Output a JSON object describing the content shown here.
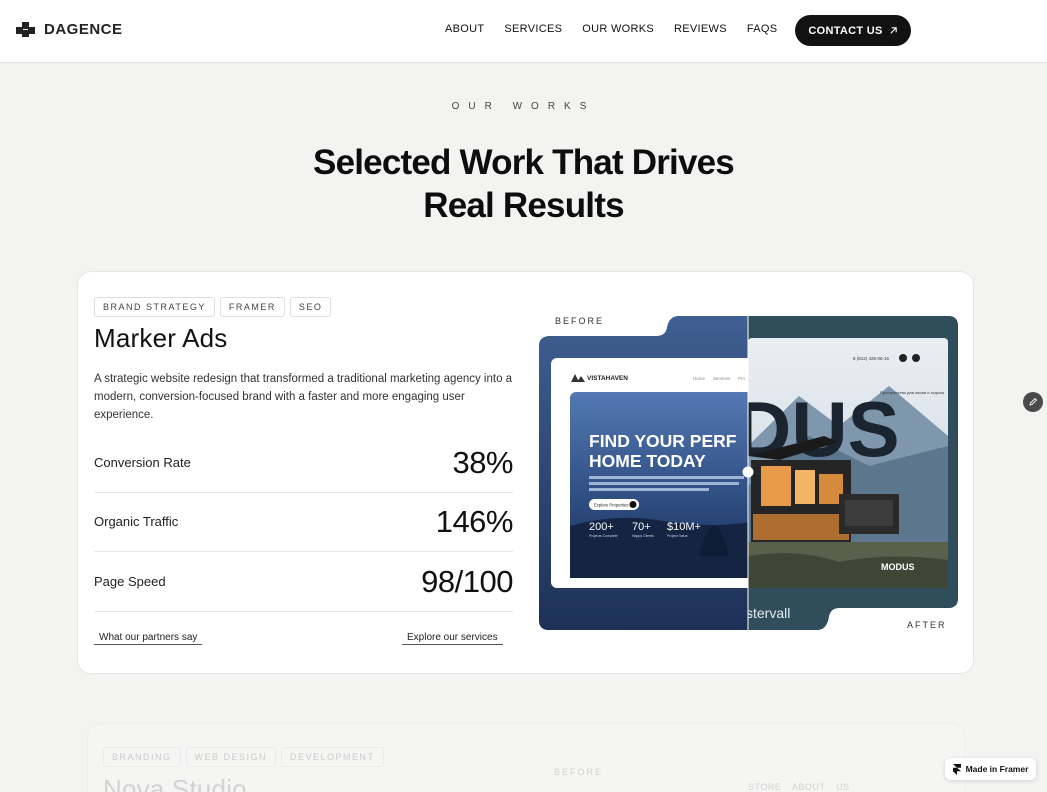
{
  "nav": {
    "logo_text": "DAGENCE",
    "links": [
      "ABOUT",
      "SERVICES",
      "OUR WORKS",
      "REVIEWS",
      "FAQS"
    ],
    "contact_label": "CONTACT US",
    "contact_icon": "arrow-up-right-icon"
  },
  "section": {
    "eyebrow": "OUR WORKS",
    "title_line1": "Selected Work That Drives",
    "title_line2": "Real Results"
  },
  "project": {
    "tags": [
      "BRAND STRATEGY",
      "FRAMER",
      "SEO"
    ],
    "name": "Marker Ads",
    "description": "A strategic website redesign that transformed a traditional marketing agency into a modern, conversion-focused brand with a faster and more engaging user experience.",
    "metrics": [
      {
        "label": "Conversion Rate",
        "value": "38%"
      },
      {
        "label": "Organic Traffic",
        "value": "146%"
      },
      {
        "label": "Page Speed",
        "value": "98/100"
      }
    ],
    "link_partners": "What our partners say",
    "link_services": "Explore our services",
    "before_label": "BEFORE",
    "after_label": "AFTER",
    "before_site": {
      "brand": "VISTAHAVEN",
      "nav": [
        "Home",
        "Services",
        "Pro"
      ],
      "headline_1": "FIND YOUR PERF",
      "headline_2": "HOME TODAY",
      "blurb": "We provide tailored real estate solutions, guiding you through every step with personalized experiences that meet your unique needs and aspirations.",
      "cta": "Explore Properties",
      "stats": [
        {
          "value": "200+",
          "label": "Projects Complete"
        },
        {
          "value": "70+",
          "label": "Happy Clients"
        },
        {
          "value": "$10M+",
          "label": "Project Value"
        }
      ]
    },
    "after_site": {
      "phone": "8 (812) 426-06-16",
      "side_text": "Пространство для жизни и отдыха",
      "big_text": "DUS",
      "brand": "MODUS",
      "footer_text": "stervall"
    }
  },
  "next_project": {
    "tags": [
      "BRANDING",
      "WEB DESIGN",
      "DEVELOPMENT"
    ],
    "name": "Nova Studio",
    "before_label": "BEFORE",
    "nav_peek": "STORE ABOUT US"
  },
  "framer_badge": "Made in Framer",
  "colors": {
    "accent_dark": "#121212",
    "page_bg": "#f3f3f2",
    "before_blue": "#2e4f86",
    "after_teal": "#2f4d5a"
  }
}
